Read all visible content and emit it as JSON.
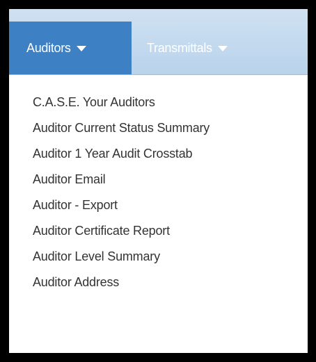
{
  "navbar": {
    "tabs": [
      {
        "label": "Auditors"
      },
      {
        "label": "Transmittals"
      }
    ]
  },
  "dropdown": {
    "items": [
      {
        "label": "C.A.S.E. Your Auditors"
      },
      {
        "label": "Auditor Current Status Summary"
      },
      {
        "label": "Auditor 1 Year Audit Crosstab"
      },
      {
        "label": "Auditor Email"
      },
      {
        "label": "Auditor - Export"
      },
      {
        "label": "Auditor Certificate Report"
      },
      {
        "label": "Auditor Level Summary"
      },
      {
        "label": "Auditor Address"
      }
    ]
  },
  "colors": {
    "active_tab": "#3d80c4",
    "navbar_bg": "#bdd5ec",
    "menu_text": "#333333",
    "frame": "#000000"
  },
  "icons": {
    "tab_caret": "caret-down-icon"
  }
}
